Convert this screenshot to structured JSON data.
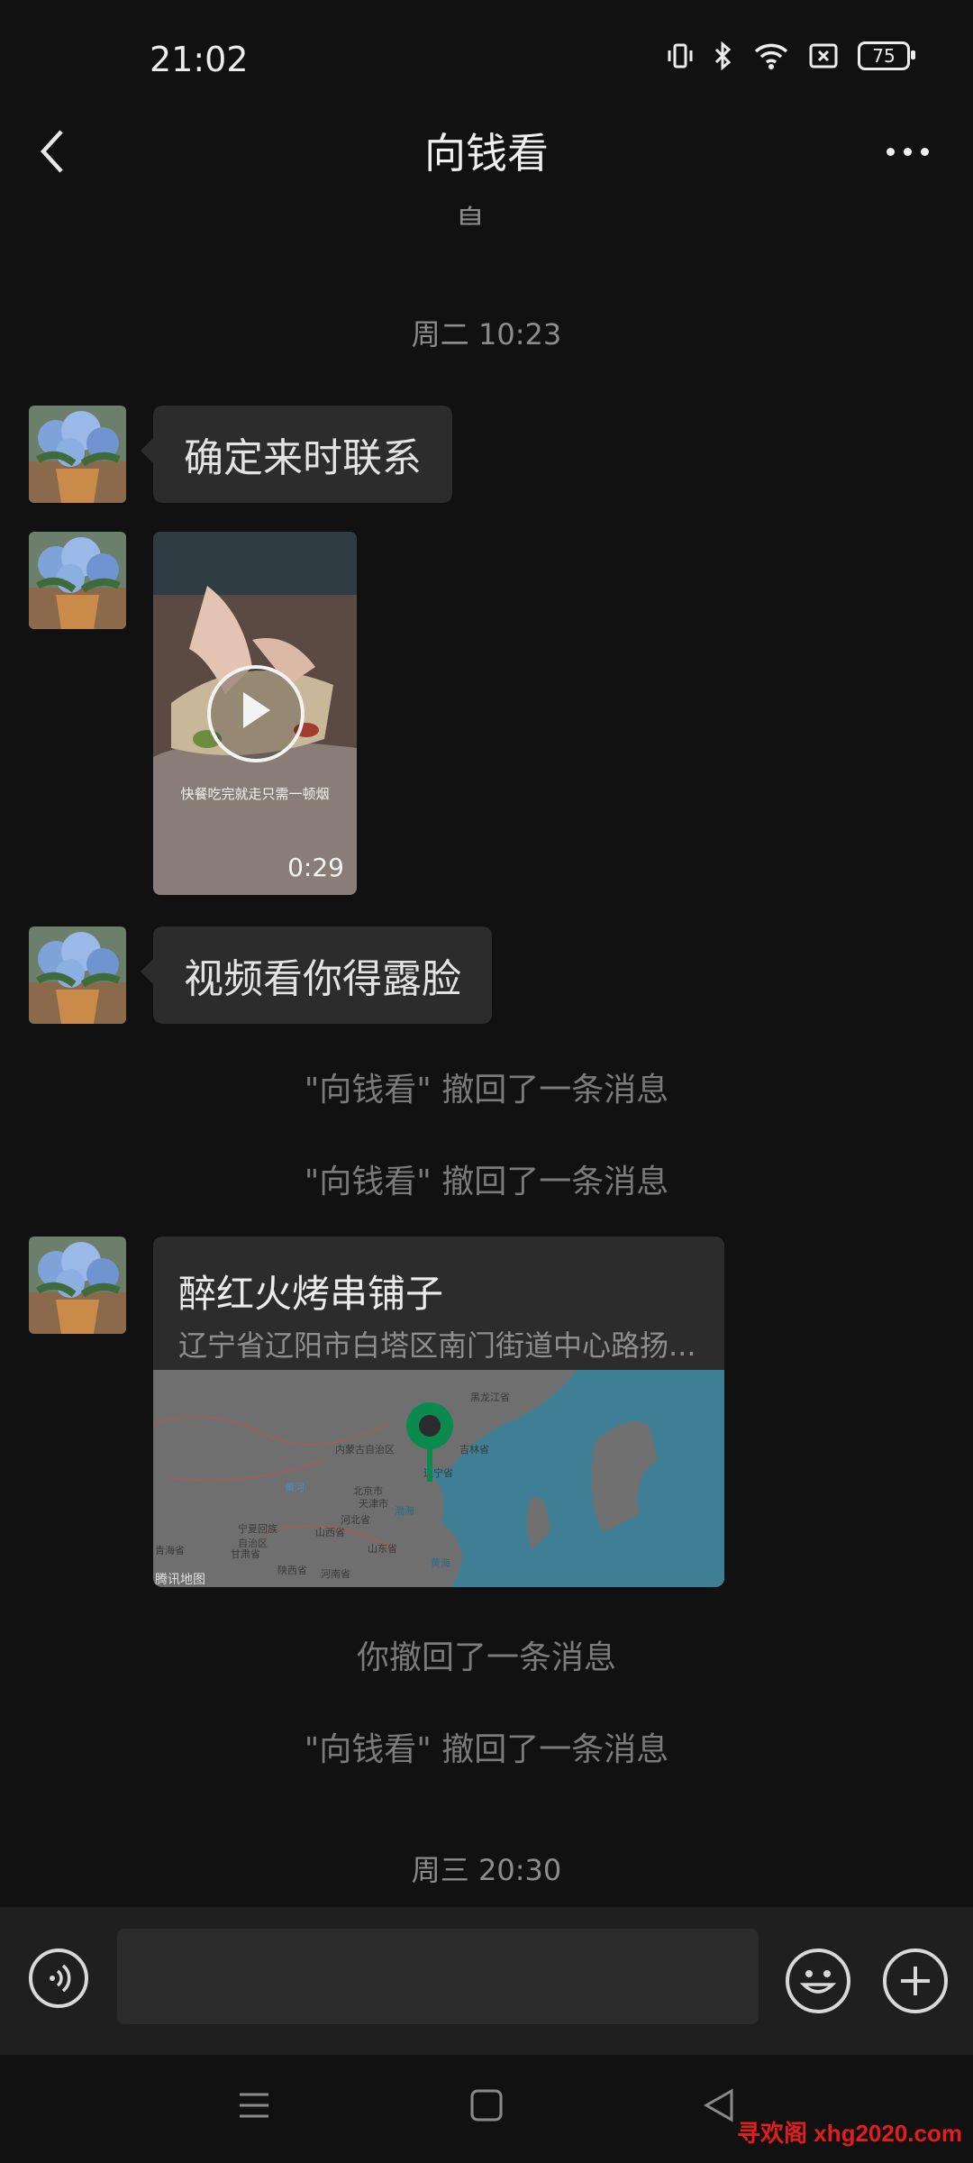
{
  "status_bar": {
    "time": "21:02",
    "battery": "75"
  },
  "header": {
    "title": "向钱看"
  },
  "top_clipped_text": "息。",
  "messages": {
    "ts1": "周二 10:23",
    "text1": "确定来时联系",
    "video": {
      "caption": "快餐吃完就走只需一顿烟",
      "duration": "0:29"
    },
    "text2": "视频看你得露脸",
    "recall1": "\"向钱看\" 撤回了一条消息",
    "recall2": "\"向钱看\" 撤回了一条消息",
    "location": {
      "name": "醉红火烤串铺子",
      "address": "辽宁省辽阳市白塔区南门街道中心路扬...",
      "map_labels": [
        "黑龙江省",
        "吉林省",
        "内蒙古自治区",
        "辽宁省",
        "北京市",
        "天津市",
        "河北省",
        "宁夏回族自治区",
        "山西省",
        "山东省",
        "甘肃省",
        "青海省",
        "陕西省",
        "河南省",
        "黄河",
        "黄海",
        "渤海"
      ],
      "map_credit": "腾讯地图"
    },
    "recall3": "你撤回了一条消息",
    "recall4": "\"向钱看\" 撤回了一条消息",
    "ts2": "周三 20:30"
  },
  "input": {
    "placeholder": ""
  },
  "watermark": "寻欢阁 xhg2020.com",
  "colors": {
    "background": "#111111",
    "bubble": "#2c2c2c",
    "map_sea": "#3d8aa6",
    "pin": "#0b8a4e"
  }
}
